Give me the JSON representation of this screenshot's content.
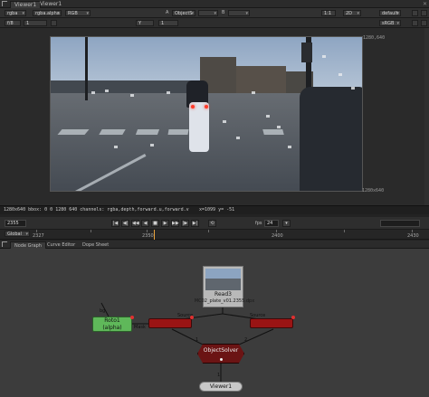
{
  "viewer_tabs": [
    "Viewer1"
  ],
  "viewer_tab_strip_title": "Viewer1",
  "controls": {
    "channels": "rgba",
    "layer": "rgba.alpha",
    "colorspace": "RGB",
    "input_a": "A",
    "input_a_value": "ObjectS",
    "input_b": "B",
    "zoom": "1:1",
    "view_mode": "2D",
    "lut": "default",
    "lut2": "sRGB",
    "fstop": "f/8",
    "frame": "1",
    "gain": "Y",
    "gamma": "1"
  },
  "viewer": {
    "format_top": "1280,640",
    "format_bottom": "1280x640",
    "info_left": "1280x640 bbox: 0 0 1280 640 channels: rgba,depth,forward.u,forward.v",
    "info_right": "x=1099 y= -51"
  },
  "timeline": {
    "current_frame": "2355",
    "fps_label": "fps",
    "fps_value": "24",
    "range_mode": "Global",
    "playback_buttons": [
      "|◀",
      "◀|",
      "◀◀",
      "◀",
      "■",
      "▶",
      "▶▶",
      "|▶",
      "▶|",
      "⟲"
    ],
    "ruler_labels": [
      "2327",
      "2350",
      "2400",
      "2430"
    ]
  },
  "panel_tabs": [
    "Node Graph",
    "Curve Editor",
    "Dope Sheet"
  ],
  "nodes": {
    "read": {
      "name": "Read3",
      "file": "MC02_plate_v01.2355.dpx"
    },
    "roto": {
      "name": "Roto1",
      "sub": "(alpha)"
    },
    "solver": {
      "name": "ObjectSolver"
    },
    "viewer": {
      "name": "Viewer1"
    }
  },
  "edge_labels": {
    "bg": "bg",
    "mask": "Mask",
    "source_left": "Source",
    "source_right": "Source",
    "in1": "1",
    "in2": "2",
    "out1": "1"
  },
  "colors": {
    "node_red": "#9a1414",
    "node_green": "#5fb85a",
    "playhead": "#e9a23b"
  }
}
